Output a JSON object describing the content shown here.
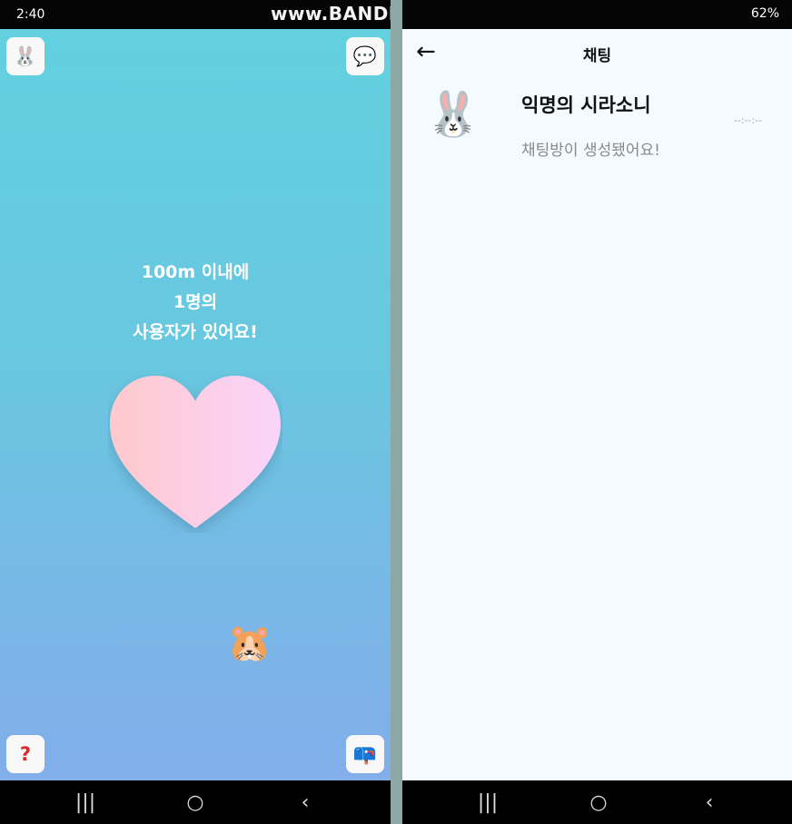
{
  "left": {
    "status": {
      "time": "2:40"
    },
    "watermark": "www.BANDICAM.com",
    "icons": {
      "profile": "bunny-emoji",
      "chat": "speech-bubble-icon",
      "help": "question-mark-icon",
      "mail": "mailbox-icon"
    },
    "nearby": {
      "line1": "100m 이내에",
      "line2": "1명의",
      "line3": "사용자가 있어요!"
    },
    "user_emoji": "pikachu-emoji"
  },
  "right": {
    "status": {
      "battery": "62%"
    },
    "header": {
      "title": "채팅"
    },
    "chat_list": [
      {
        "name": "익명의 시라소니",
        "time": "--:--:--",
        "last_message": "채팅방이 생성됐어요!",
        "avatar": "bunny-emoji"
      }
    ]
  },
  "nav": {
    "recent": "|||",
    "home": "○",
    "back": "‹"
  },
  "colors": {
    "heart_start": "#ffc7cf",
    "heart_end": "#fbd3fb",
    "bg_top": "#62d0df",
    "bg_bottom": "#82aeea"
  }
}
